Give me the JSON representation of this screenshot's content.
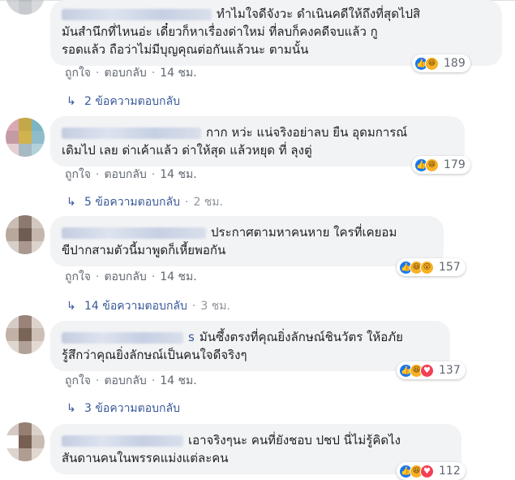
{
  "comments": [
    {
      "text": "ทำไมใจดีจังวะ ดำเนินคดีให้ถึงที่สุดไปสิ มันสำนึกที่ไหนอ่ะ เดี๋ยวก็หาเรื่องด่าใหม่ ที่ลบก็คงคดีจบแล้ว กูรอดแล้ว ถือว่าไม่มีบุญคุณต่อกันแล้วนะ ตามนั้น",
      "line1": "ทำไมใจดีจังวะ ดำเนินคดีให้ถึงที่สุดไปสิ",
      "line2": "มันสำนึกที่ไหนอ่ะ เดี๋ยวก็หาเรื่องด่าใหม่ ที่ลบก็คงคดีจบแล้ว กู",
      "line3": "รอดแล้ว ถือว่าไม่มีบุญคุณต่อกันแล้วนะ ตามนั้น",
      "reaction_count": "189",
      "reactions": [
        "like-icon",
        "haha-icon"
      ],
      "like_label": "ถูกใจ",
      "reply_label": "ตอบกลับ",
      "time": "14 ชม.",
      "replies_label": "2 ข้อความตอบกลับ",
      "replies_time": ""
    },
    {
      "line1": "กาก หว่ะ แน่จริงอย่าลบ ยืน อุดมการณ์",
      "line2": "เดิมไป เลย ด่าเค้าแล้ว ด่าให้สุด แล้วหยุด ที่ ลุงตู่",
      "reaction_count": "179",
      "reactions": [
        "like-icon",
        "haha-icon"
      ],
      "like_label": "ถูกใจ",
      "reply_label": "ตอบกลับ",
      "time": "14 ชม.",
      "replies_label": "5 ข้อความตอบกลับ",
      "replies_time": "2 ชม."
    },
    {
      "line1": "ประกาศตามหาคนหาย ใครที่เคยอม",
      "line2": "ขีปากสามตัวนี้มาพูดก็เหี้ยพอกัน",
      "reaction_count": "157",
      "reactions": [
        "like-icon",
        "haha-icon",
        "wow-icon"
      ],
      "like_label": "ถูกใจ",
      "reply_label": "ตอบกลับ",
      "time": "14 ชม.",
      "replies_label": "14 ข้อความตอบกลับ",
      "replies_time": "3 ชม."
    },
    {
      "name_suffix": "s",
      "line1": "มันซึ้งตรงที่คุณยิ่งลักษณ์ชินวัตร ให้อภัย",
      "line2": "รู้สึกว่าคุณยิ่งลักษณ์เป็นคนใจดีจริงๆ",
      "reaction_count": "137",
      "reactions": [
        "like-icon",
        "haha-icon",
        "love-icon"
      ],
      "like_label": "ถูกใจ",
      "reply_label": "ตอบกลับ",
      "time": "14 ชม.",
      "replies_label": "3 ข้อความตอบกลับ",
      "replies_time": ""
    },
    {
      "line1": "เอาจริงๆนะ คนที่ยังชอบ ปชป นี่ไม่รู้คิดไง",
      "line2": "สันดานคนในพรรคแม่งแต่ละคน",
      "reaction_count": "112",
      "reactions": [
        "like-icon",
        "haha-icon",
        "love-icon"
      ]
    }
  ],
  "colors": {
    "link": "#385898",
    "meta": "#606770",
    "bubble": "#f2f3f5",
    "like": "#1877f2",
    "haha": "#f7b125",
    "love": "#f33e58"
  }
}
